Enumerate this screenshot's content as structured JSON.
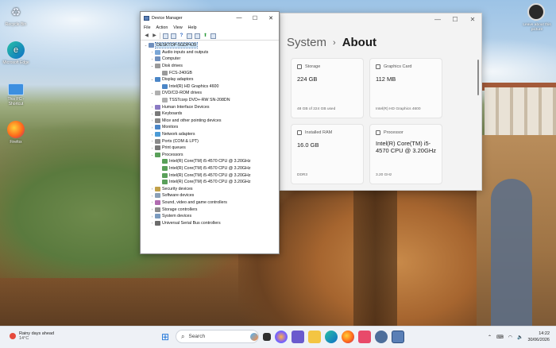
{
  "desktop": {
    "icons": [
      {
        "label": "Recycle Bin",
        "icon": "recycle-bin-icon"
      },
      {
        "label": "Microsoft Edge",
        "icon": "edge-icon"
      },
      {
        "label": "This PC - Shortcut",
        "icon": "this-pc-icon"
      },
      {
        "label": "Firefox",
        "icon": "firefox-icon"
      }
    ],
    "right_icon_label": "Leave about this picture"
  },
  "device_manager": {
    "title": "Device Manager",
    "menu": [
      "File",
      "Action",
      "View",
      "Help"
    ],
    "root": "DESKTOP-5GDP4J9",
    "tree": [
      {
        "label": "Audio inputs and outputs",
        "expanded": false,
        "children": []
      },
      {
        "label": "Computer",
        "expanded": false,
        "children": []
      },
      {
        "label": "Disk drives",
        "expanded": true,
        "children": [
          "FCS-240GB"
        ]
      },
      {
        "label": "Display adaptors",
        "expanded": true,
        "children": [
          "Intel(R) HD Graphics 4600"
        ]
      },
      {
        "label": "DVD/CD-ROM drives",
        "expanded": true,
        "children": [
          "TSSTcorp DVD+-RW SN-208DN"
        ]
      },
      {
        "label": "Human Interface Devices",
        "expanded": false,
        "children": []
      },
      {
        "label": "Keyboards",
        "expanded": false,
        "children": []
      },
      {
        "label": "Mice and other pointing devices",
        "expanded": false,
        "children": []
      },
      {
        "label": "Monitors",
        "expanded": false,
        "children": []
      },
      {
        "label": "Network adapters",
        "expanded": false,
        "children": []
      },
      {
        "label": "Ports (COM & LPT)",
        "expanded": false,
        "children": []
      },
      {
        "label": "Print queues",
        "expanded": false,
        "children": []
      },
      {
        "label": "Processors",
        "expanded": true,
        "children": [
          "Intel(R) Core(TM) i5-4570 CPU @ 3.20GHz",
          "Intel(R) Core(TM) i5-4570 CPU @ 3.20GHz",
          "Intel(R) Core(TM) i5-4570 CPU @ 3.20GHz",
          "Intel(R) Core(TM) i5-4570 CPU @ 3.20GHz"
        ]
      },
      {
        "label": "Security devices",
        "expanded": false,
        "children": []
      },
      {
        "label": "Software devices",
        "expanded": false,
        "children": []
      },
      {
        "label": "Sound, video and game controllers",
        "expanded": false,
        "children": []
      },
      {
        "label": "Storage controllers",
        "expanded": false,
        "children": []
      },
      {
        "label": "System devices",
        "expanded": false,
        "children": []
      },
      {
        "label": "Universal Serial Bus controllers",
        "expanded": false,
        "children": []
      }
    ]
  },
  "settings": {
    "breadcrumb_parent": "System",
    "breadcrumb_current": "About",
    "cards": [
      {
        "title": "Storage",
        "value": "224 GB",
        "sub": "48 GB of 224 GB used",
        "icon": "storage-icon"
      },
      {
        "title": "Graphics Card",
        "value": "112 MB",
        "sub": "Intel(R) HD Graphics 4600",
        "icon": "graphics-card-icon"
      },
      {
        "title": "Installed RAM",
        "value": "16.0 GB",
        "sub": "DDR3",
        "icon": "ram-icon"
      },
      {
        "title": "Processor",
        "value": "Intel(R) Core(TM) i5-4570 CPU @ 3.20GHz",
        "sub": "3.20 GHz",
        "icon": "processor-icon"
      }
    ]
  },
  "taskbar": {
    "weather_line1": "Rainy days ahead",
    "weather_line2": "14°C",
    "search_placeholder": "Search",
    "time": "14:22",
    "date": "30/06/2026"
  }
}
